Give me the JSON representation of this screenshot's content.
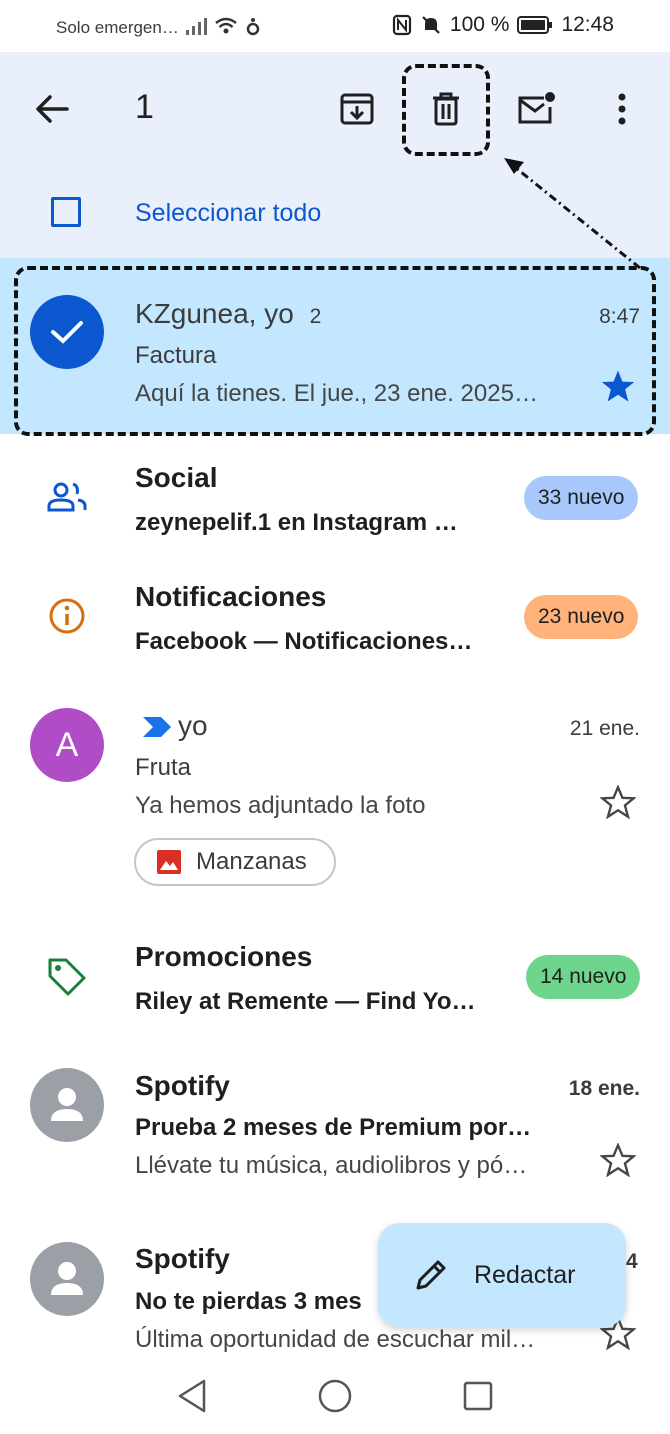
{
  "status_bar": {
    "carrier": "Solo emergen…",
    "battery": "100 %",
    "time": "12:48"
  },
  "action_bar": {
    "selected_count": "1",
    "select_all": "Seleccionar todo"
  },
  "emails": [
    {
      "sender": "KZgunea, yo",
      "thread_count": "2",
      "time": "8:47",
      "subject": "Factura",
      "snippet": "Aquí la tienes. El jue., 23 ene. 2025…"
    },
    {
      "category": "Social",
      "preview": "zeynepelif.1 en Instagram …",
      "badge": "33 nuevo",
      "badge_color": "#a8c7fa"
    },
    {
      "category": "Notificaciones",
      "preview": "Facebook — Notificaciones…",
      "badge": "23 nuevo",
      "badge_color": "#ffb27a"
    },
    {
      "avatar": "A",
      "sender": "yo",
      "time": "21 ene.",
      "subject": "Fruta",
      "snippet": "Ya hemos adjuntado la foto",
      "attachment": "Manzanas"
    },
    {
      "category": "Promociones",
      "preview": "Riley at Remente — Find Yo…",
      "badge": "14 nuevo",
      "badge_color": "#6dd58c"
    },
    {
      "sender": "Spotify",
      "time": "18 ene.",
      "subject": "Prueba 2 meses de Premium por…",
      "snippet": "Llévate tu música, audiolibros y pó…"
    },
    {
      "sender": "Spotify",
      "time": "4",
      "subject": "No te pierdas 3 mes",
      "snippet": "Última oportunidad de escuchar mil…"
    }
  ],
  "fab": {
    "label": "Redactar"
  },
  "colors": {
    "accent": "#0b57d0",
    "selected_bg": "#c2e7ff",
    "header_bg": "#e9f0fb",
    "avatar_a": "#b04cc5",
    "avatar_default": "#9aa0a6"
  },
  "icons": [
    "back-arrow-icon",
    "archive-icon",
    "trash-icon",
    "mark-unread-icon",
    "more-vert-icon",
    "check-icon",
    "star-filled-icon",
    "people-icon",
    "info-icon",
    "important-icon",
    "star-outline-icon",
    "image-icon",
    "tag-icon",
    "person-icon",
    "pencil-icon",
    "nav-back-icon",
    "nav-home-icon",
    "nav-recents-icon"
  ]
}
